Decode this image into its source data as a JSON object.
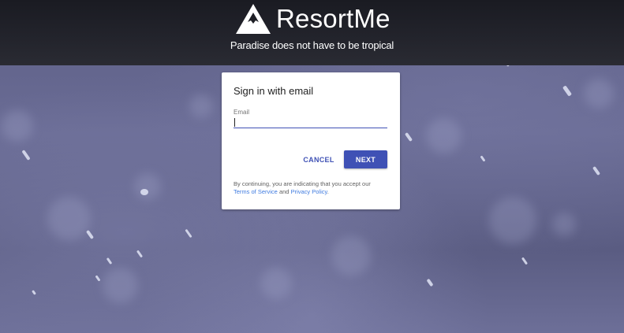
{
  "brand": {
    "name": "ResortMe",
    "tagline": "Paradise does not have to be tropical"
  },
  "signin": {
    "title": "Sign in with email",
    "email_label": "Email",
    "email_value": "",
    "cancel_label": "CANCEL",
    "next_label": "NEXT",
    "legal_prefix": "By continuing, you are indicating that you accept our",
    "terms_link": "Terms of Service",
    "and_text": "and",
    "privacy_link": "Privacy Policy",
    "period": "."
  },
  "colors": {
    "accent": "#3f51b5",
    "link": "#3f7be0",
    "header_bg": "#1f2027",
    "background": "#62648c"
  },
  "icons": {
    "logo": "mountain-triangle-icon"
  }
}
